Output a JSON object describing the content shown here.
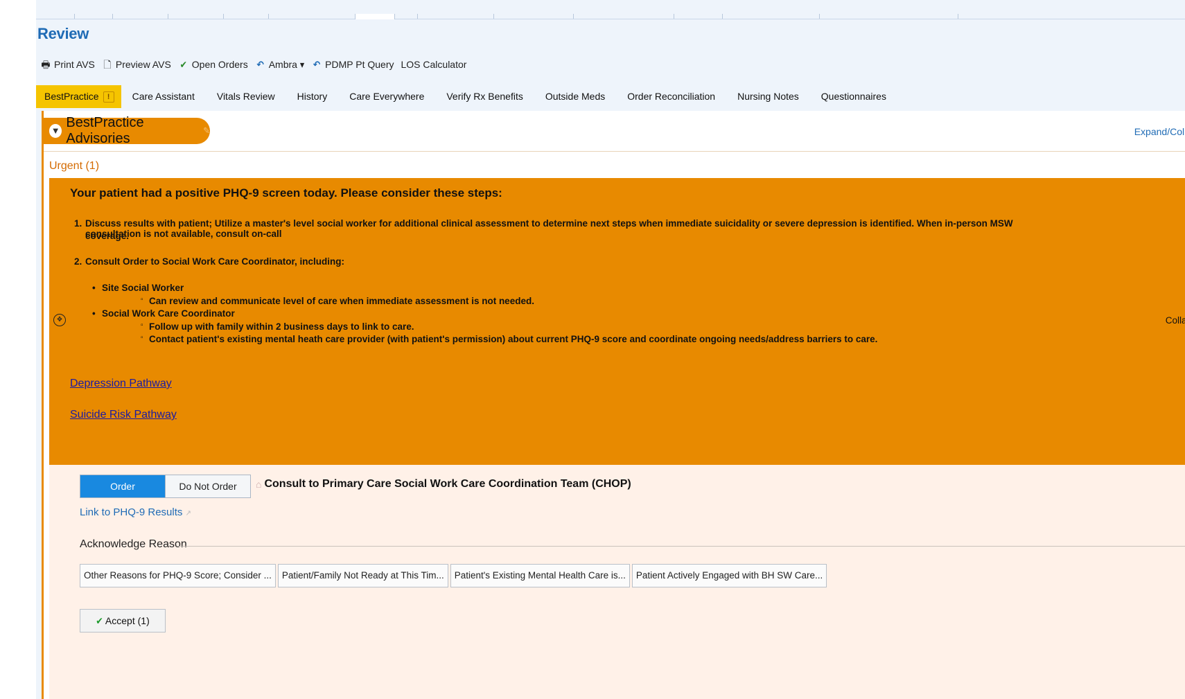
{
  "page_title": "Review",
  "toolbar": [
    {
      "icon": "printer-icon",
      "glyph": "🖶",
      "label": "Print AVS"
    },
    {
      "icon": "preview-icon",
      "glyph": "🗋",
      "label": "Preview AVS"
    },
    {
      "icon": "checkmark-icon",
      "glyph": "✔",
      "label": "Open Orders"
    },
    {
      "icon": "return-arrow-icon",
      "glyph": "↶",
      "label": "Ambra ▾"
    },
    {
      "icon": "return-arrow-icon",
      "glyph": "↶",
      "label": "PDMP Pt Query"
    },
    {
      "icon": "",
      "glyph": "",
      "label": "LOS Calculator"
    }
  ],
  "tabs": [
    "BestPractice",
    "Care Assistant",
    "Vitals Review",
    "History",
    "Care Everywhere",
    "Verify Rx Benefits",
    "Outside Meds",
    "Order Reconciliation",
    "Nursing Notes",
    "Questionnaires"
  ],
  "tab_warning_glyph": "!",
  "panel": {
    "title": "BestPractice Advisories",
    "expand_label": "Expand/Colla",
    "urgent_label": "Urgent (1)"
  },
  "alert": {
    "heading": "Your patient had a positive PHQ-9 screen today. Please consider these steps:",
    "step1_num": "1.",
    "step1_line1": "Discuss results with patient; Utilize a master's level social worker for additional clinical assessment to determine next steps when immediate suicidality or severe depression is identified. When in-person MSW  consultation is not available, consult on-call",
    "step1_line2": "coverage.",
    "step2_num": "2.",
    "step2": "Consult Order to Social Work Care Coordinator, including:",
    "bullet1": "Site Social Worker",
    "bullet1_sub1": "Can review and communicate level of care when immediate assessment is not needed.",
    "bullet2": "Social Work Care Coordinator",
    "bullet2_sub1": "Follow up with family within 2 business days to link to care.",
    "bullet2_sub2": "Contact patient's existing mental heath care provider (with patient's permission) about current PHQ-9 score and coordinate ongoing needs/address barriers to care.",
    "link1": "Depression Pathway",
    "link2": "Suicide Risk Pathway",
    "collapse_label": "Collap"
  },
  "order": {
    "order_label": "Order",
    "do_not_order_label": "Do Not Order",
    "title": "Consult to Primary Care Social Work Care Coordination Team (CHOP)",
    "phq_link": "Link to PHQ-9 Results",
    "ack_label": "Acknowledge Reason",
    "reasons": [
      "Other Reasons for PHQ-9 Score; Consider ...",
      "Patient/Family Not Ready at This Tim...",
      "Patient's Existing Mental Health Care is...",
      "Patient Actively Engaged with BH SW Care..."
    ],
    "accept_label": "Accept",
    "accept_count": "(1)"
  }
}
